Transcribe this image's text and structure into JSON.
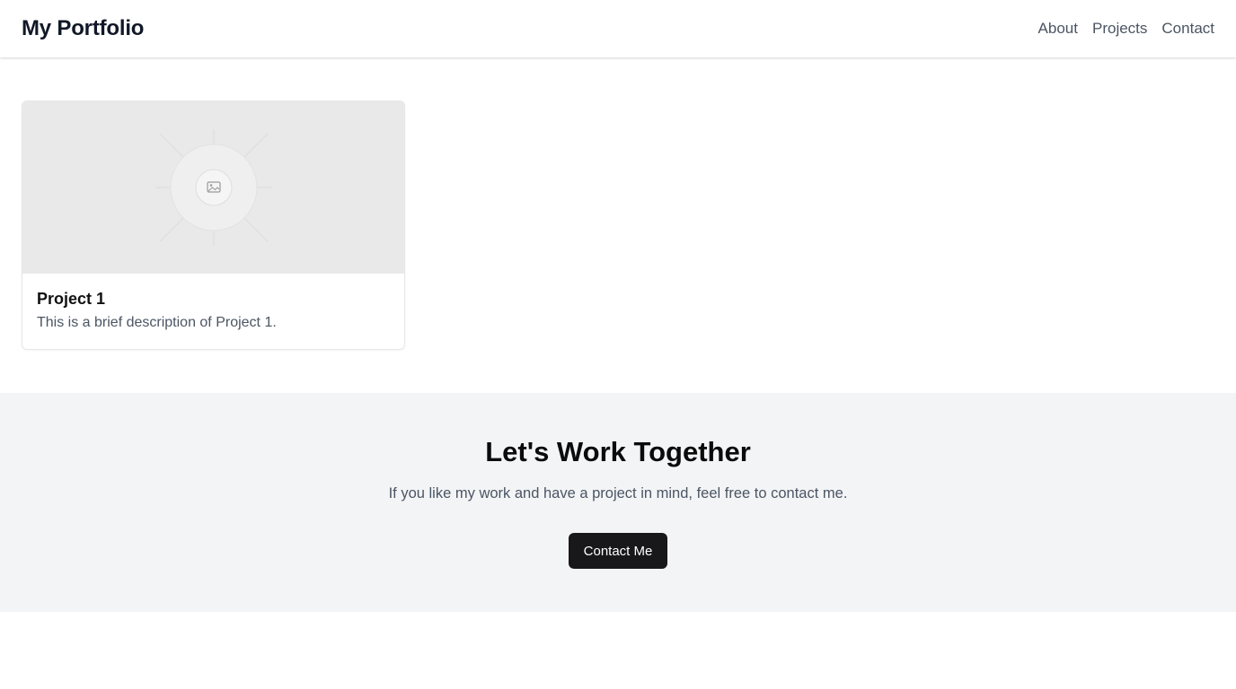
{
  "header": {
    "brand": "My Portfolio",
    "nav": [
      {
        "label": "About"
      },
      {
        "label": "Projects"
      },
      {
        "label": "Contact"
      }
    ]
  },
  "projects": [
    {
      "title": "Project 1",
      "description": "This is a brief description of Project 1.",
      "image_icon": "image-placeholder-icon"
    }
  ],
  "cta": {
    "title": "Let's Work Together",
    "text": "If you like my work and have a project in mind, feel free to contact me.",
    "button_label": "Contact Me"
  },
  "colors": {
    "cta_background": "#f3f4f6",
    "button_background": "#18181b",
    "placeholder_background": "#e9e9e9"
  }
}
